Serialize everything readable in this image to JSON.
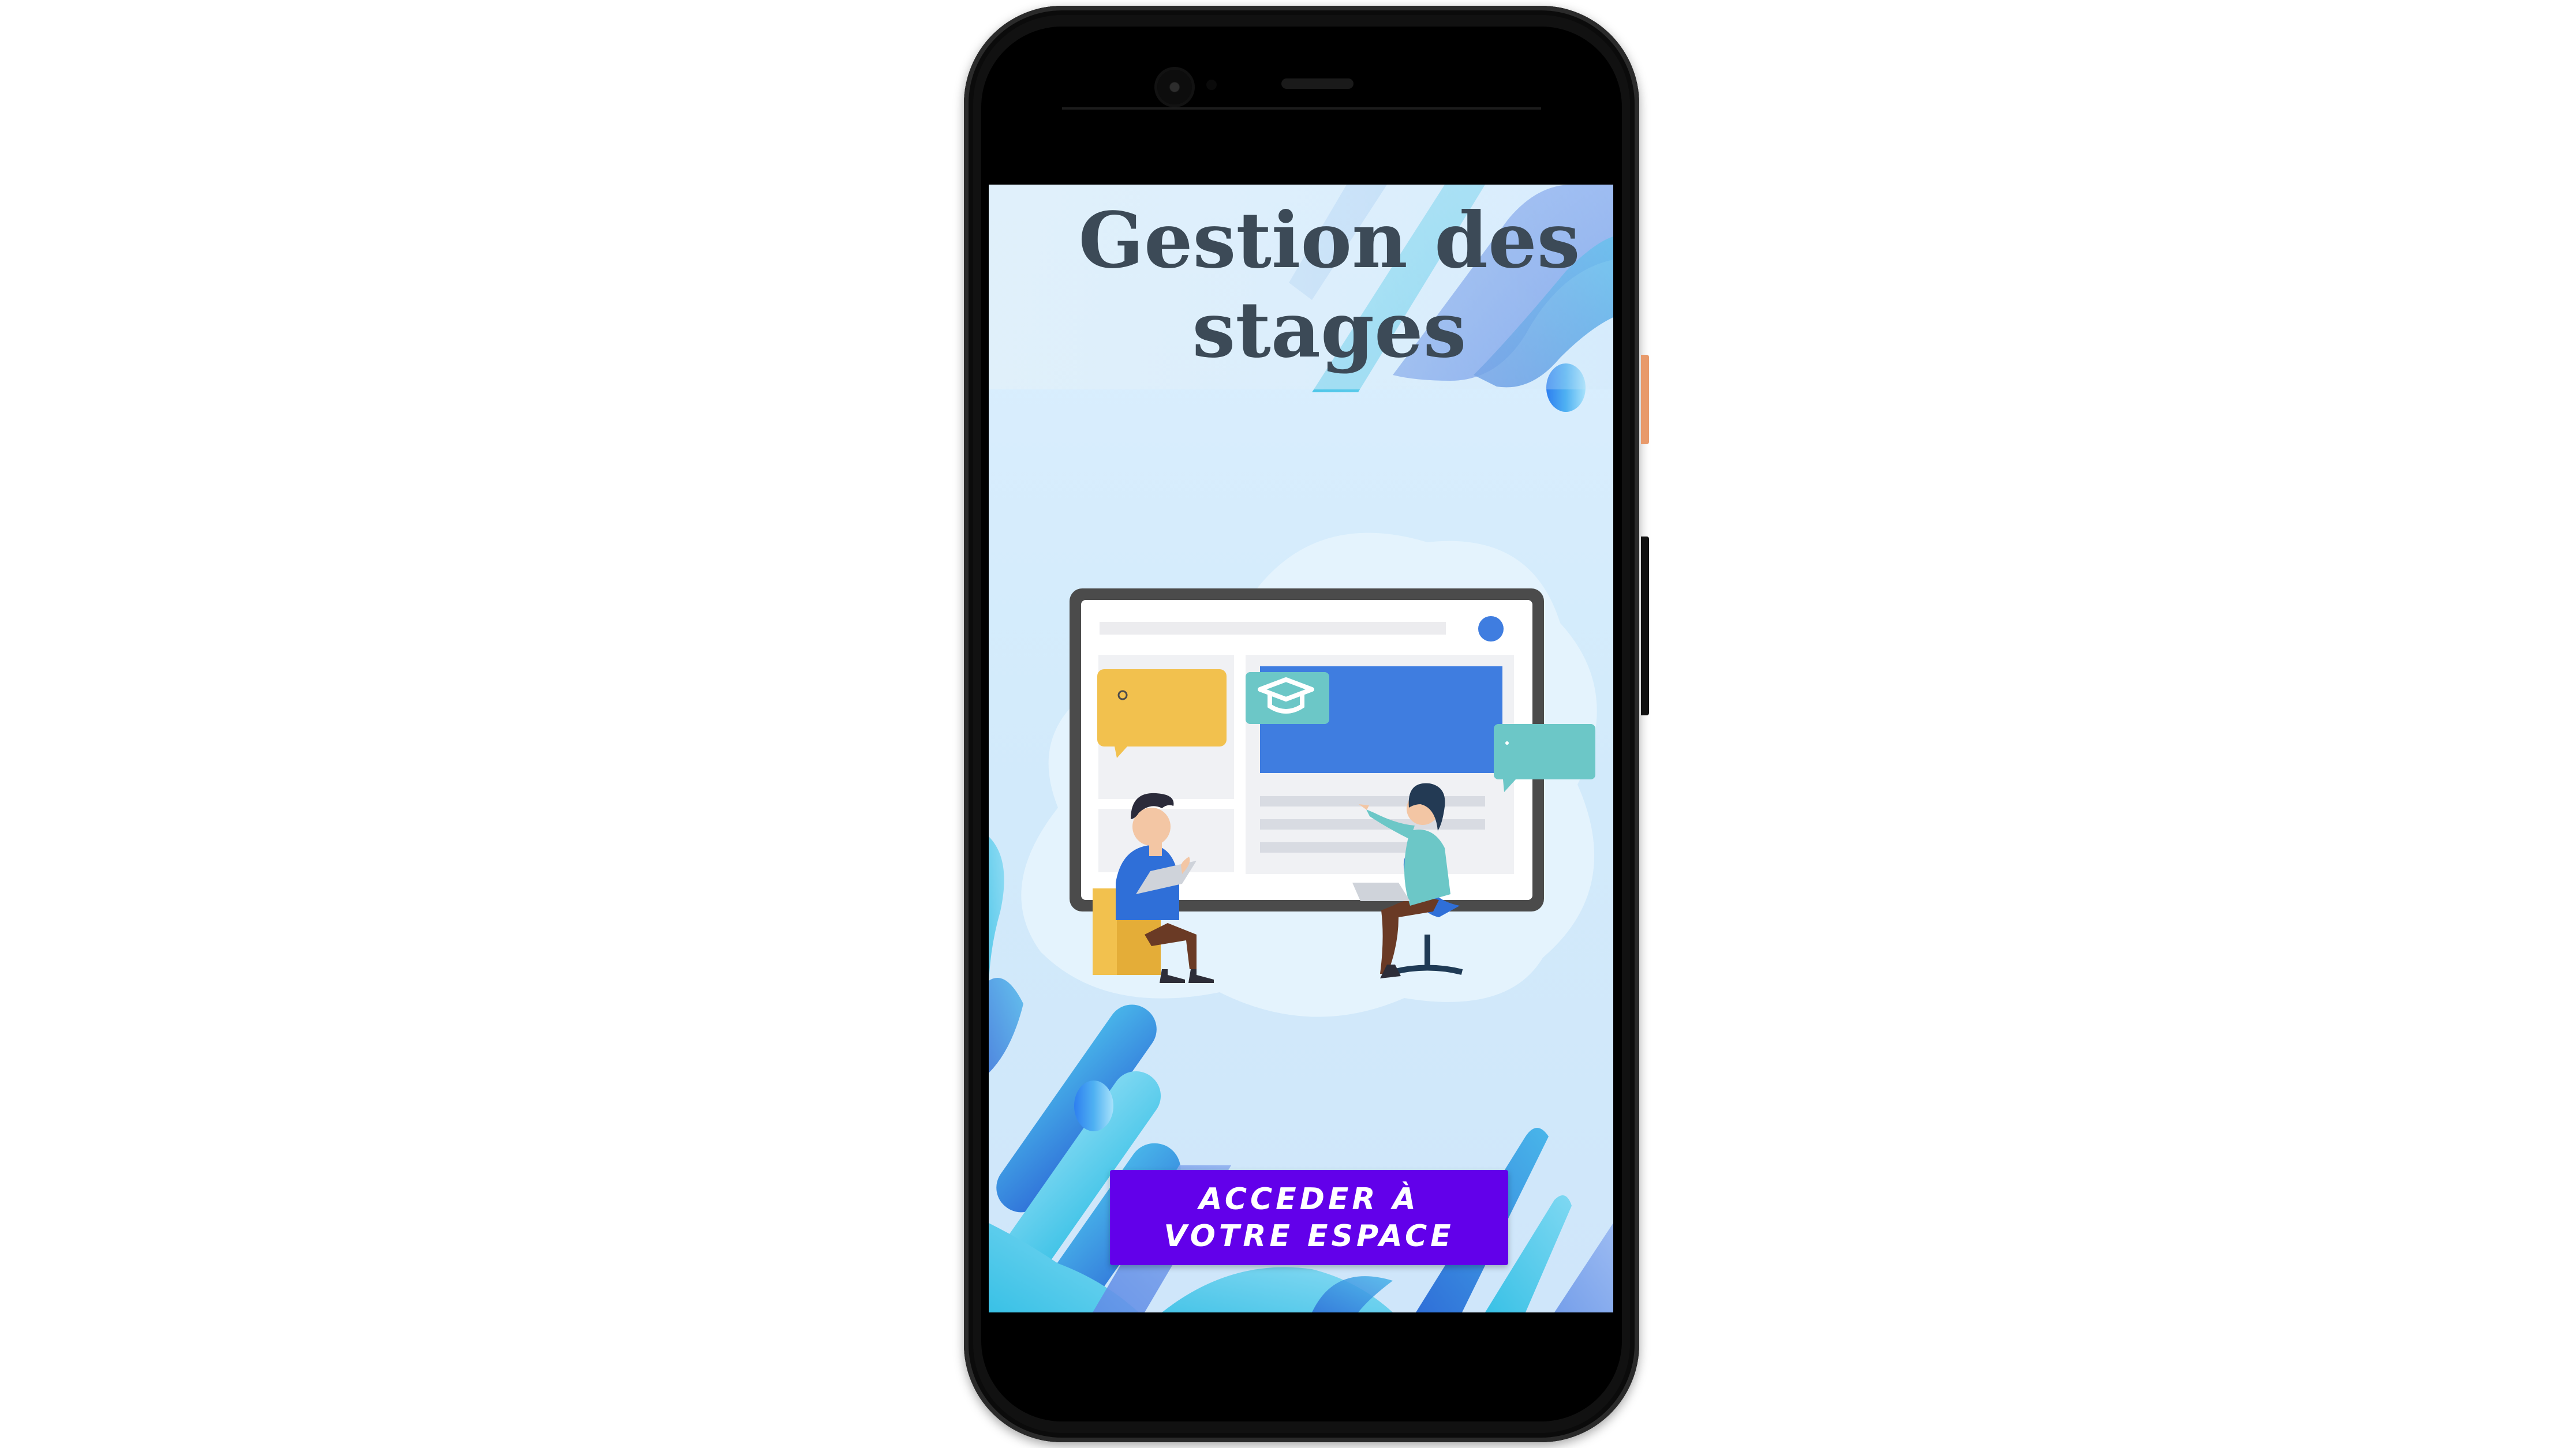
{
  "screen": {
    "title": "Gestion des stages",
    "cta_label": "ACCEDER À VOTRE ESPACE"
  },
  "illustration": {
    "subject": "students-collaboration",
    "icon": "graduation-cap-icon"
  },
  "colors": {
    "cta_background": "#6200ea",
    "cta_text": "#ffffff",
    "title_text": "#3c4a57",
    "screen_background": "#d3ebfb",
    "accent_blue": "#3f7de0",
    "accent_yellow": "#f2c14e",
    "accent_teal": "#6cc7c7"
  }
}
